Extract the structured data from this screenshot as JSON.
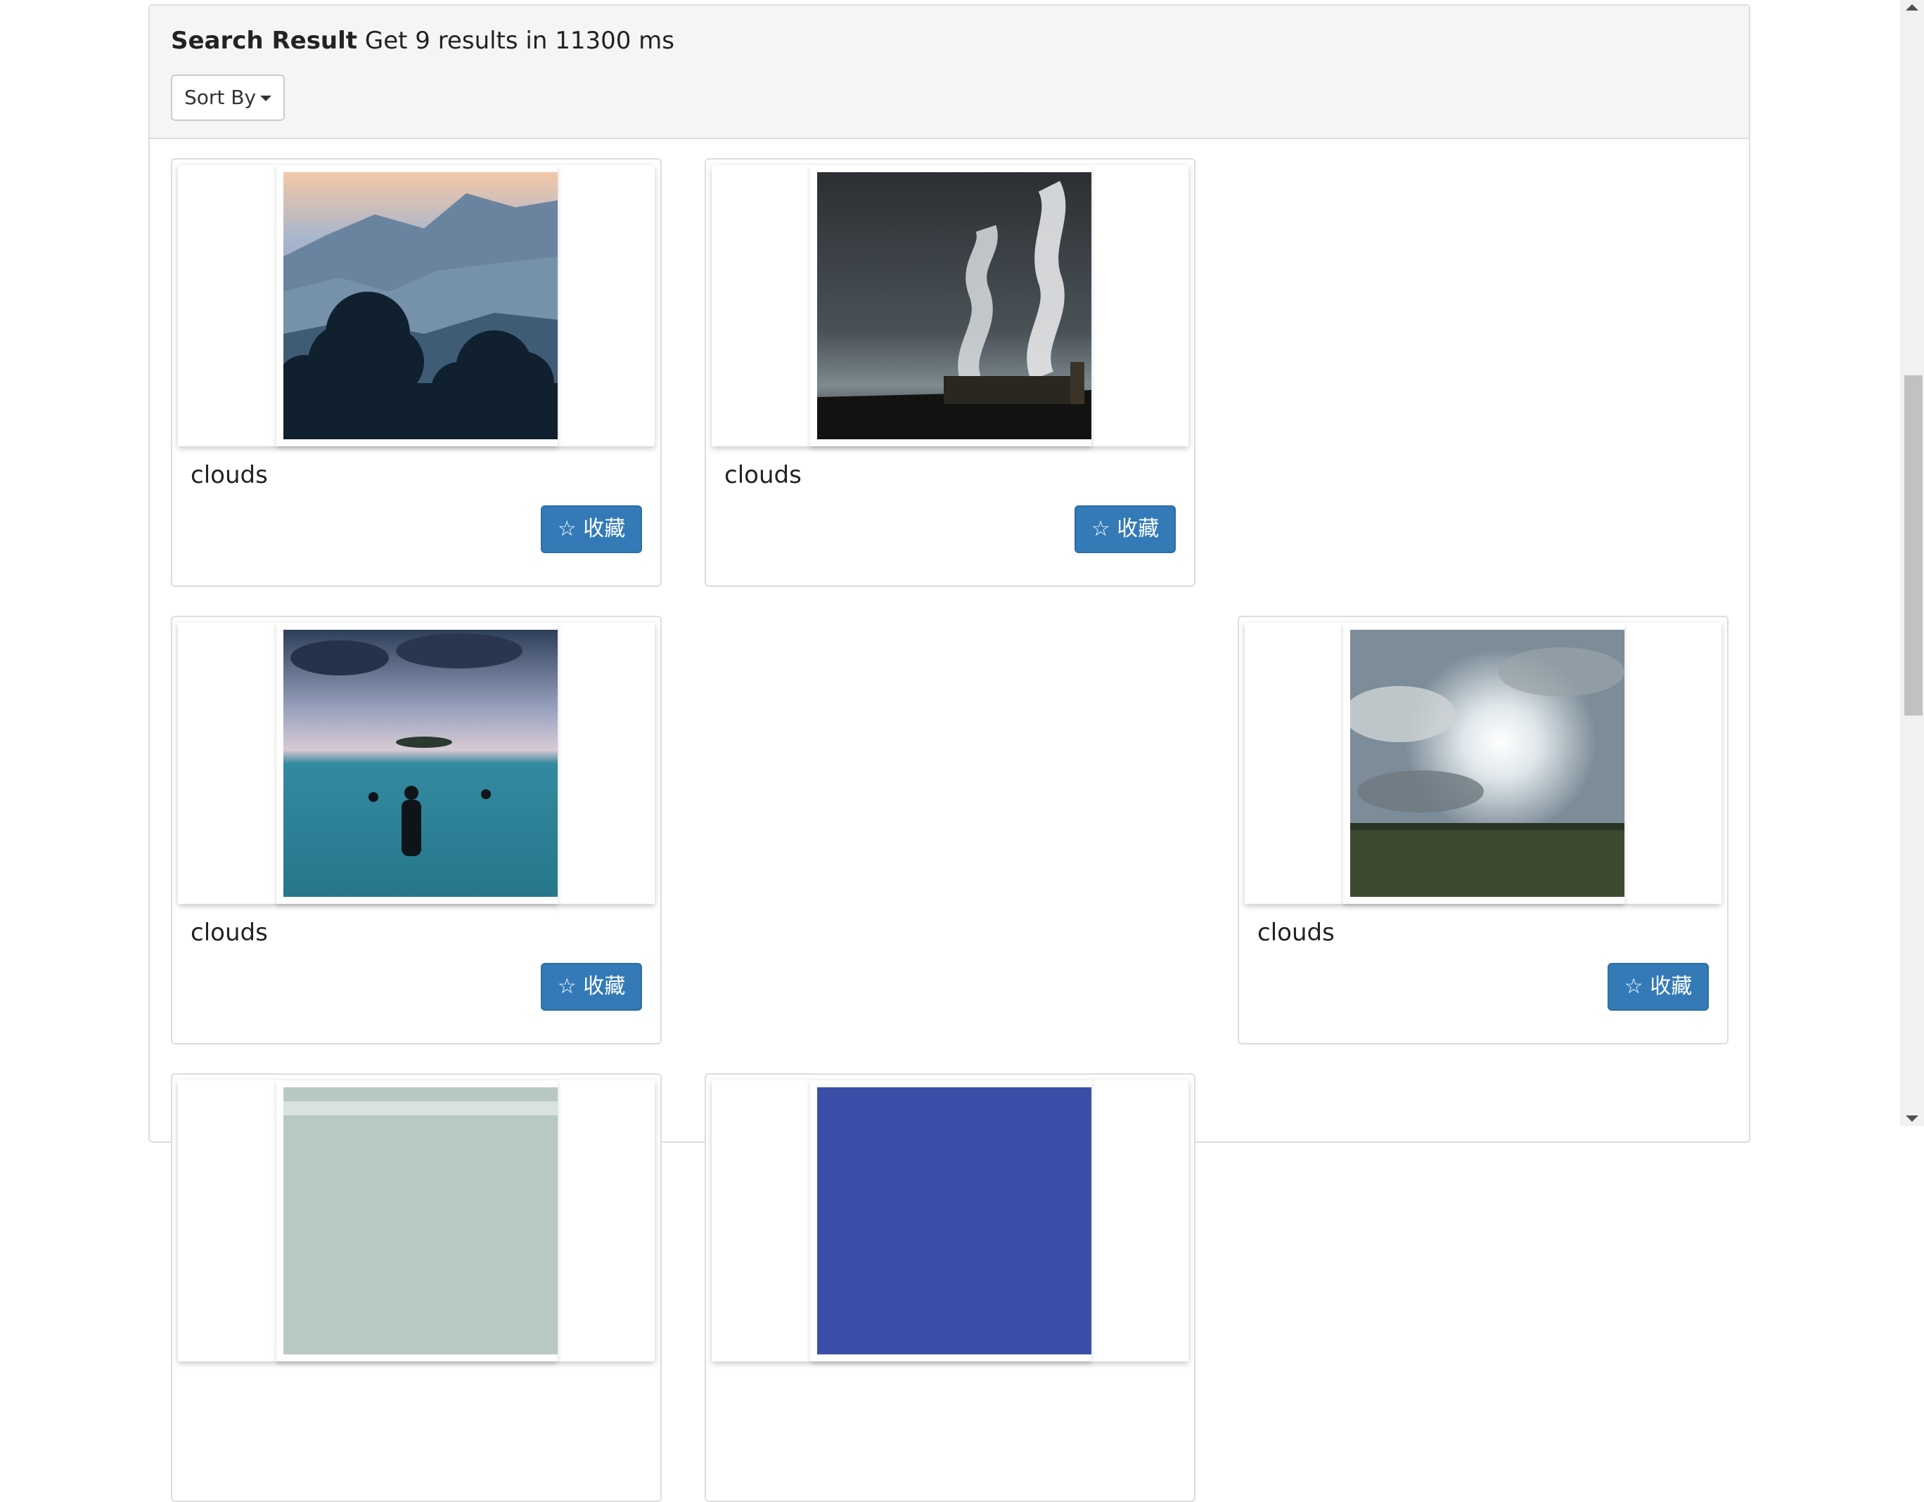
{
  "header": {
    "title_bold": "Search Result",
    "summary": "Get 9 results in 11300 ms",
    "sort_label": "Sort By"
  },
  "results": [
    {
      "label": "clouds",
      "button_icon": "☆",
      "button_text": "收藏",
      "image": "misty-mountains-forest"
    },
    {
      "label": "clouds",
      "button_icon": "☆",
      "button_text": "收藏",
      "image": "factory-smoke-storm"
    },
    {
      "label": "clouds",
      "button_icon": "☆",
      "button_text": "收藏",
      "image": "sea-swimmers"
    },
    {
      "label": "clouds",
      "button_icon": "☆",
      "button_text": "收藏",
      "image": "sun-clouds-field"
    },
    {
      "label": "",
      "image": "light-sky-sea"
    },
    {
      "label": "",
      "image": "blue-sky"
    }
  ],
  "colors": {
    "primary": "#337ab7",
    "heading_bg": "#f5f5f5",
    "border": "#dddddd"
  }
}
